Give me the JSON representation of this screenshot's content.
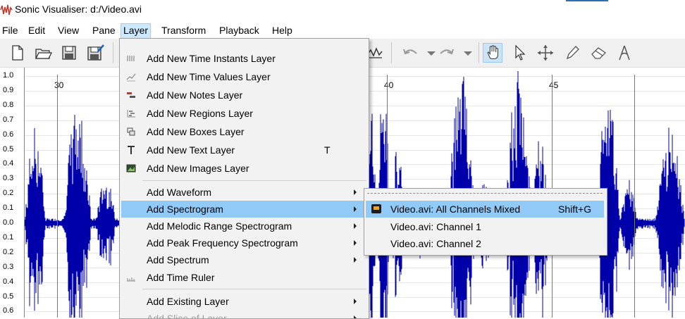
{
  "window": {
    "title": "Sonic Visualiser: d:/Video.avi"
  },
  "menubar": {
    "items": [
      {
        "label": "File"
      },
      {
        "label": "Edit"
      },
      {
        "label": "View"
      },
      {
        "label": "Pane"
      },
      {
        "label": "Layer"
      },
      {
        "label": "Transform"
      },
      {
        "label": "Playback"
      },
      {
        "label": "Help"
      }
    ]
  },
  "toolbar": {
    "icons": [
      "new-file-icon",
      "open-folder-icon",
      "save-icon",
      "save-session-icon",
      "undo-icon",
      "redo-icon",
      "navigate-hand-icon",
      "select-arrow-icon",
      "move-icon",
      "draw-pencil-icon",
      "erase-icon",
      "measure-icon"
    ]
  },
  "ruler": {
    "y_ticks": [
      "1.0",
      "0.9",
      "0.8",
      "0.7",
      "0.6",
      "0.5",
      "0.4",
      "0.3",
      "0.2",
      "0.1",
      "0.0",
      "0.1",
      "0.2",
      "0.3",
      "0.4",
      "0.5",
      "0.6"
    ],
    "x_labels": [
      "30",
      "40",
      "45"
    ]
  },
  "colors": {
    "waveform": "#0000aa",
    "menu_highlight": "#91c9f7"
  },
  "layer_menu": {
    "items": [
      {
        "label": "Add New Time Instants Layer",
        "icon": "time-instants-icon"
      },
      {
        "label": "Add New Time Values Layer",
        "icon": "time-values-icon"
      },
      {
        "label": "Add New Notes Layer",
        "icon": "notes-icon"
      },
      {
        "label": "Add New Regions Layer",
        "icon": "regions-icon"
      },
      {
        "label": "Add New Boxes Layer",
        "icon": "boxes-icon"
      },
      {
        "label": "Add New Text Layer",
        "icon": "text-icon",
        "shortcut": "T"
      },
      {
        "label": "Add New Images Layer",
        "icon": "images-icon"
      },
      {
        "label": "Add Waveform",
        "submenu": true
      },
      {
        "label": "Add Spectrogram",
        "submenu": true
      },
      {
        "label": "Add Melodic Range Spectrogram",
        "submenu": true
      },
      {
        "label": "Add Peak Frequency Spectrogram",
        "submenu": true
      },
      {
        "label": "Add Spectrum",
        "submenu": true
      },
      {
        "label": "Add Time Ruler",
        "icon": "time-ruler-icon"
      },
      {
        "label": "Add Existing Layer",
        "submenu": true
      },
      {
        "label": "Add Slice of Layer",
        "submenu": true
      }
    ]
  },
  "spectrogram_submenu": {
    "items": [
      {
        "label": "Video.avi: All Channels Mixed",
        "shortcut": "Shift+G"
      },
      {
        "label": "Video.avi: Channel 1"
      },
      {
        "label": "Video.avi: Channel 2"
      }
    ]
  }
}
